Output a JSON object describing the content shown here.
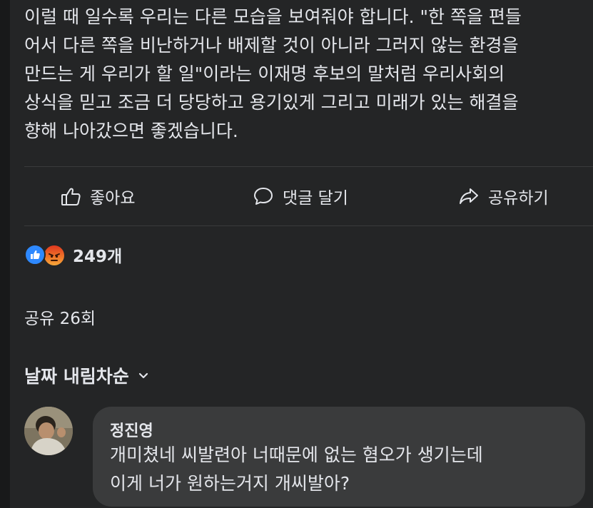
{
  "post": {
    "text_lines": [
      "이럴 때 일수록 우리는 다른 모습을 보여줘야 합니다. \"한 쪽을 편들",
      "어서 다른 쪽을 비난하거나 배제할 것이 아니라 그러지 않는 환경을",
      "만드는 게 우리가 할 일\"이라는 이재명 후보의 말처럼 우리사회의",
      "상식을 믿고 조금 더 당당하고 용기있게 그리고 미래가 있는 해결을",
      "향해 나아갔으면 좋겠습니다."
    ]
  },
  "actions": {
    "like_label": "좋아요",
    "comment_label": "댓글 달기",
    "share_label": "공유하기"
  },
  "reactions": {
    "count": "249개",
    "icons": [
      "like-icon",
      "angry-icon"
    ]
  },
  "shares": {
    "label": "공유 26회"
  },
  "sort": {
    "label": "날짜 내림차순"
  },
  "comment": {
    "author": "정진영",
    "text_lines": [
      "개미쳤네 씨발련아 너때문에 없는 혐오가 생기는데",
      "이게 너가 원하는거지 개씨발아?"
    ]
  },
  "colors": {
    "background": "#18191a",
    "card": "#242526",
    "bubble": "#3a3b3c",
    "text": "#e4e6eb",
    "like_blue": "#2e89ff"
  }
}
